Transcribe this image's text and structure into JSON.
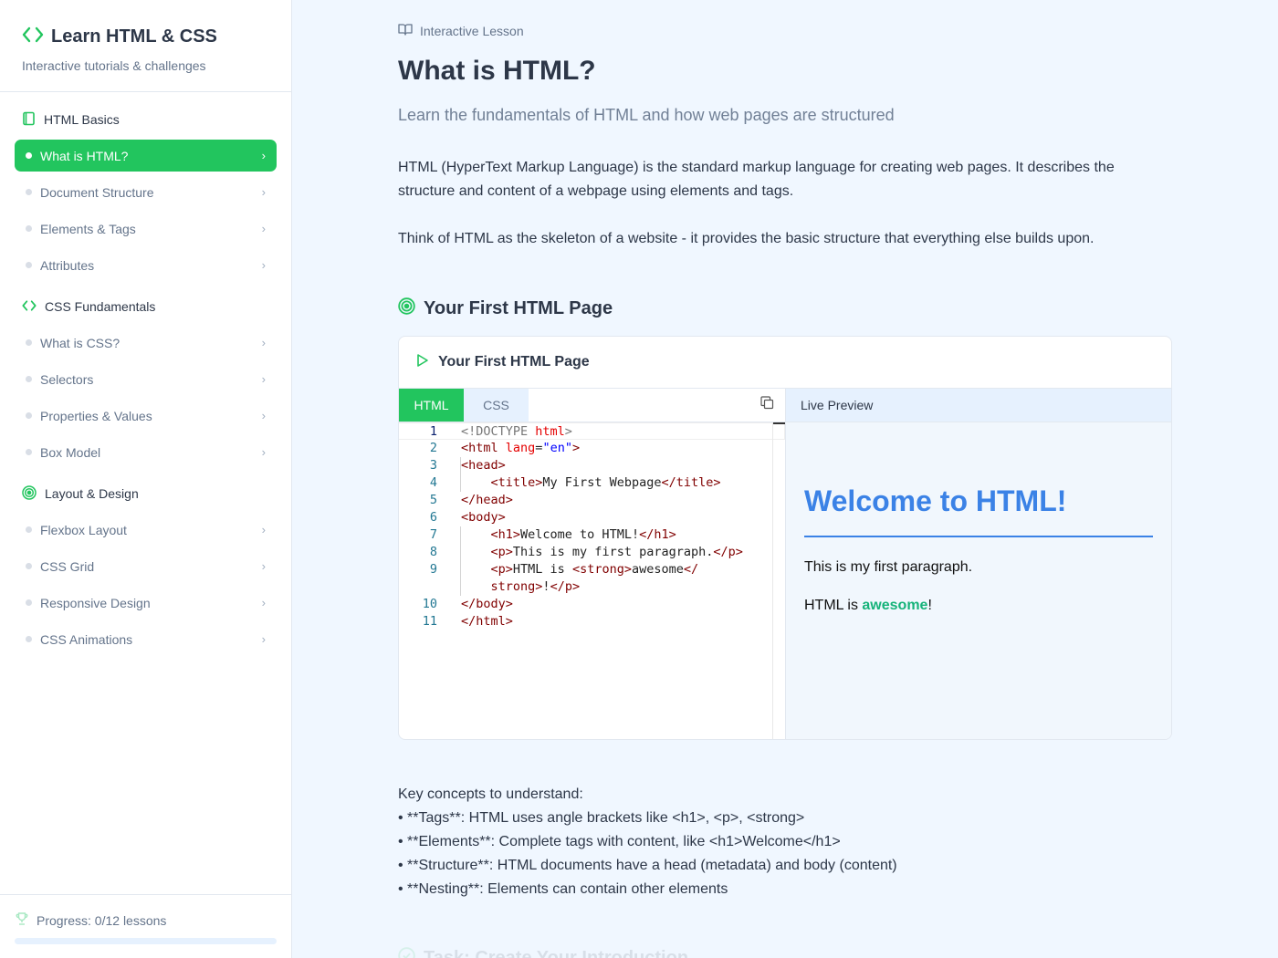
{
  "brand": {
    "title": "Learn HTML & CSS",
    "subtitle": "Interactive tutorials & challenges"
  },
  "sections": [
    {
      "title": "HTML Basics",
      "icon": "book-icon",
      "items": [
        "What is HTML?",
        "Document Structure",
        "Elements & Tags",
        "Attributes"
      ]
    },
    {
      "title": "CSS Fundamentals",
      "icon": "code-icon",
      "items": [
        "What is CSS?",
        "Selectors",
        "Properties & Values",
        "Box Model"
      ]
    },
    {
      "title": "Layout & Design",
      "icon": "target-icon",
      "items": [
        "Flexbox Layout",
        "CSS Grid",
        "Responsive Design",
        "CSS Animations"
      ]
    }
  ],
  "active_item": "What is HTML?",
  "progress": {
    "label": "Progress: 0/12 lessons",
    "fraction": 0
  },
  "lesson": {
    "crumb": "Interactive Lesson",
    "title": "What is HTML?",
    "subtitle": "Learn the fundamentals of HTML and how web pages are structured",
    "para1": "HTML (HyperText Markup Language) is the standard markup language for creating web pages. It describes the structure and content of a webpage using elements and tags.",
    "para2": "Think of HTML as the skeleton of a website - it provides the basic structure that everything else builds upon.",
    "section_heading": "Your First HTML Page"
  },
  "editor": {
    "title": "Your First HTML Page",
    "tabs": [
      "HTML",
      "CSS"
    ],
    "active_tab": "HTML",
    "preview_label": "Live Preview",
    "line_numbers": [
      "1",
      "2",
      "3",
      "4",
      "5",
      "6",
      "7",
      "8",
      "9",
      "",
      "10",
      "11"
    ]
  },
  "preview": {
    "h1": "Welcome to HTML!",
    "p1": "This is my first paragraph.",
    "p2_before": "HTML is ",
    "p2_strong": "awesome",
    "p2_after": "!"
  },
  "concepts": {
    "intro": "Key concepts to understand:",
    "items": [
      "• **Tags**: HTML uses angle brackets like <h1>, <p>, <strong>",
      "• **Elements**: Complete tags with content, like <h1>Welcome</h1>",
      "• **Structure**: HTML documents have a head (metadata) and body (content)",
      "• **Nesting**: Elements can contain other elements"
    ]
  },
  "next_heading": "Task: Create Your Introduction",
  "colors": {
    "accent": "#22c55e",
    "preview_heading": "#3b82e6",
    "strong": "#16b37a"
  }
}
